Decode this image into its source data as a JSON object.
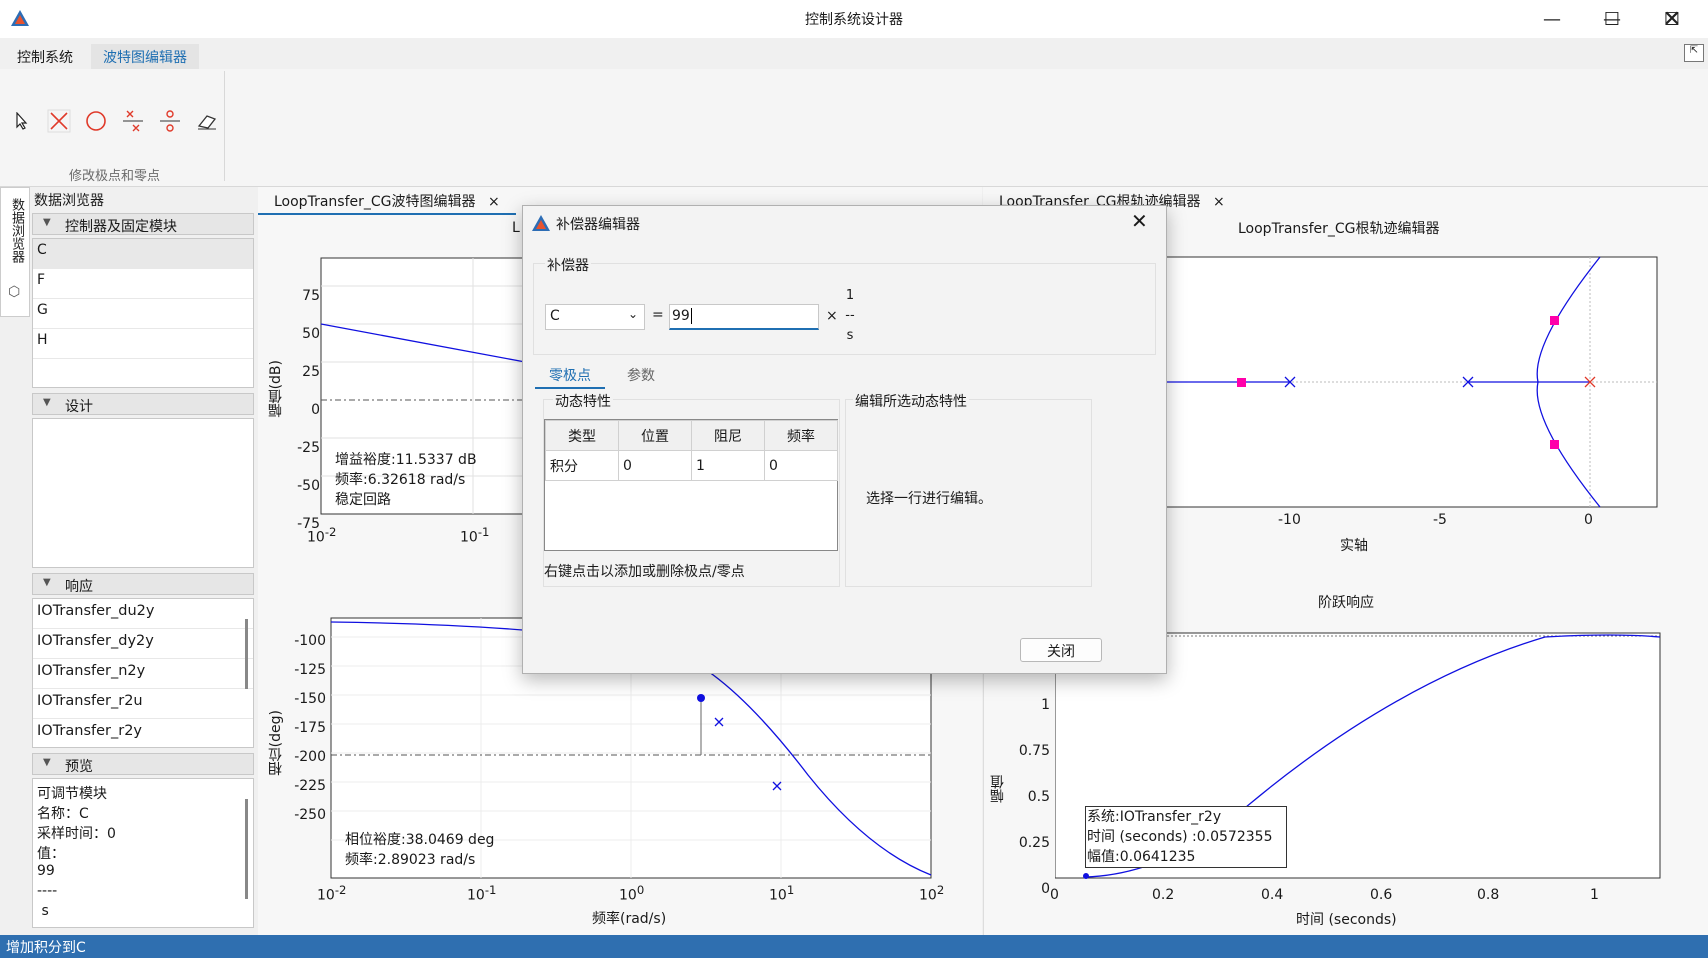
{
  "app": {
    "title": "控制系统设计器"
  },
  "ribbon": {
    "tabs": [
      "控制系统",
      "波特图编辑器"
    ],
    "group_label": "修改极点和零点"
  },
  "side_tab": "数据浏览器",
  "browser": {
    "title": "数据浏览器",
    "controllers_header": "控制器及固定模块",
    "controllers": [
      "C",
      "F",
      "G",
      "H"
    ],
    "design_header": "设计",
    "responses_header": "响应",
    "responses": [
      "IOTransfer_du2y",
      "IOTransfer_dy2y",
      "IOTransfer_n2y",
      "IOTransfer_r2u",
      "IOTransfer_r2y"
    ],
    "preview_header": "预览",
    "preview_lines": [
      "可调节模块",
      "名称：C",
      "采样时间：0",
      "值：",
      "99",
      "----",
      " s"
    ]
  },
  "doc_tabs": {
    "bode": "LoopTransfer_CG波特图编辑器",
    "rlocus": "LoopTransfer_CG根轨迹编辑器",
    "close": "×"
  },
  "bode": {
    "title_partial": "L",
    "mag_ylabel": "幅值(dB)",
    "mag_yticks": [
      "75",
      "50",
      "25",
      "0",
      "-25",
      "-50",
      "-75"
    ],
    "phase_ylabel": "相位(deg)",
    "phase_yticks": [
      "-100",
      "-125",
      "-150",
      "-175",
      "-200",
      "-225",
      "-250"
    ],
    "xlabel": "频率(rad/s)",
    "gain_margin_text": "增益裕度:11.5337 dB",
    "gain_freq_text": "频率:6.32618 rad/s",
    "stable_text": "稳定回路",
    "phase_margin_text": "相位裕度:38.0469 deg",
    "phase_freq_text": "频率:2.89023 rad/s"
  },
  "rlocus": {
    "title": "LoopTransfer_CG根轨迹编辑器",
    "xlabel": "实轴",
    "xticks": [
      "-10",
      "-5",
      "0"
    ]
  },
  "step": {
    "title": "阶跃响应",
    "ylabel": "幅值",
    "xlabel": "时间 (seconds)",
    "yticks": [
      "1",
      "0.75",
      "0.5",
      "0.25",
      "0"
    ],
    "xticks": [
      "0",
      "0.2",
      "0.4",
      "0.6",
      "0.8",
      "1"
    ],
    "tooltip": [
      "系统:IOTransfer_r2y",
      "时间 (seconds) :0.0572355",
      "幅值:0.0641235"
    ]
  },
  "dialog": {
    "title": "补偿器编辑器",
    "group_label": "补偿器",
    "selected_compensator": "C",
    "equals": "=",
    "gain_value": "99",
    "times": "×",
    "frac_num": "1",
    "frac_bar": "--",
    "frac_den": "s",
    "tabs": [
      "零极点",
      "参数"
    ],
    "dyn_group": "动态特性",
    "edit_group": "编辑所选动态特性",
    "columns": [
      "类型",
      "位置",
      "阻尼",
      "频率"
    ],
    "rows": [
      [
        "积分",
        "0",
        "1",
        "0"
      ]
    ],
    "hint": "右键点击以添加或删除极点/零点",
    "edit_hint": "选择一行进行编辑。",
    "close_button": "关闭"
  },
  "status_bar": "增加积分到C",
  "colors": {
    "curve": "#1010e0",
    "pole_zero_highlight": "#ff00aa",
    "status": "#2f6fb0",
    "accent": "#1f6fb2"
  }
}
